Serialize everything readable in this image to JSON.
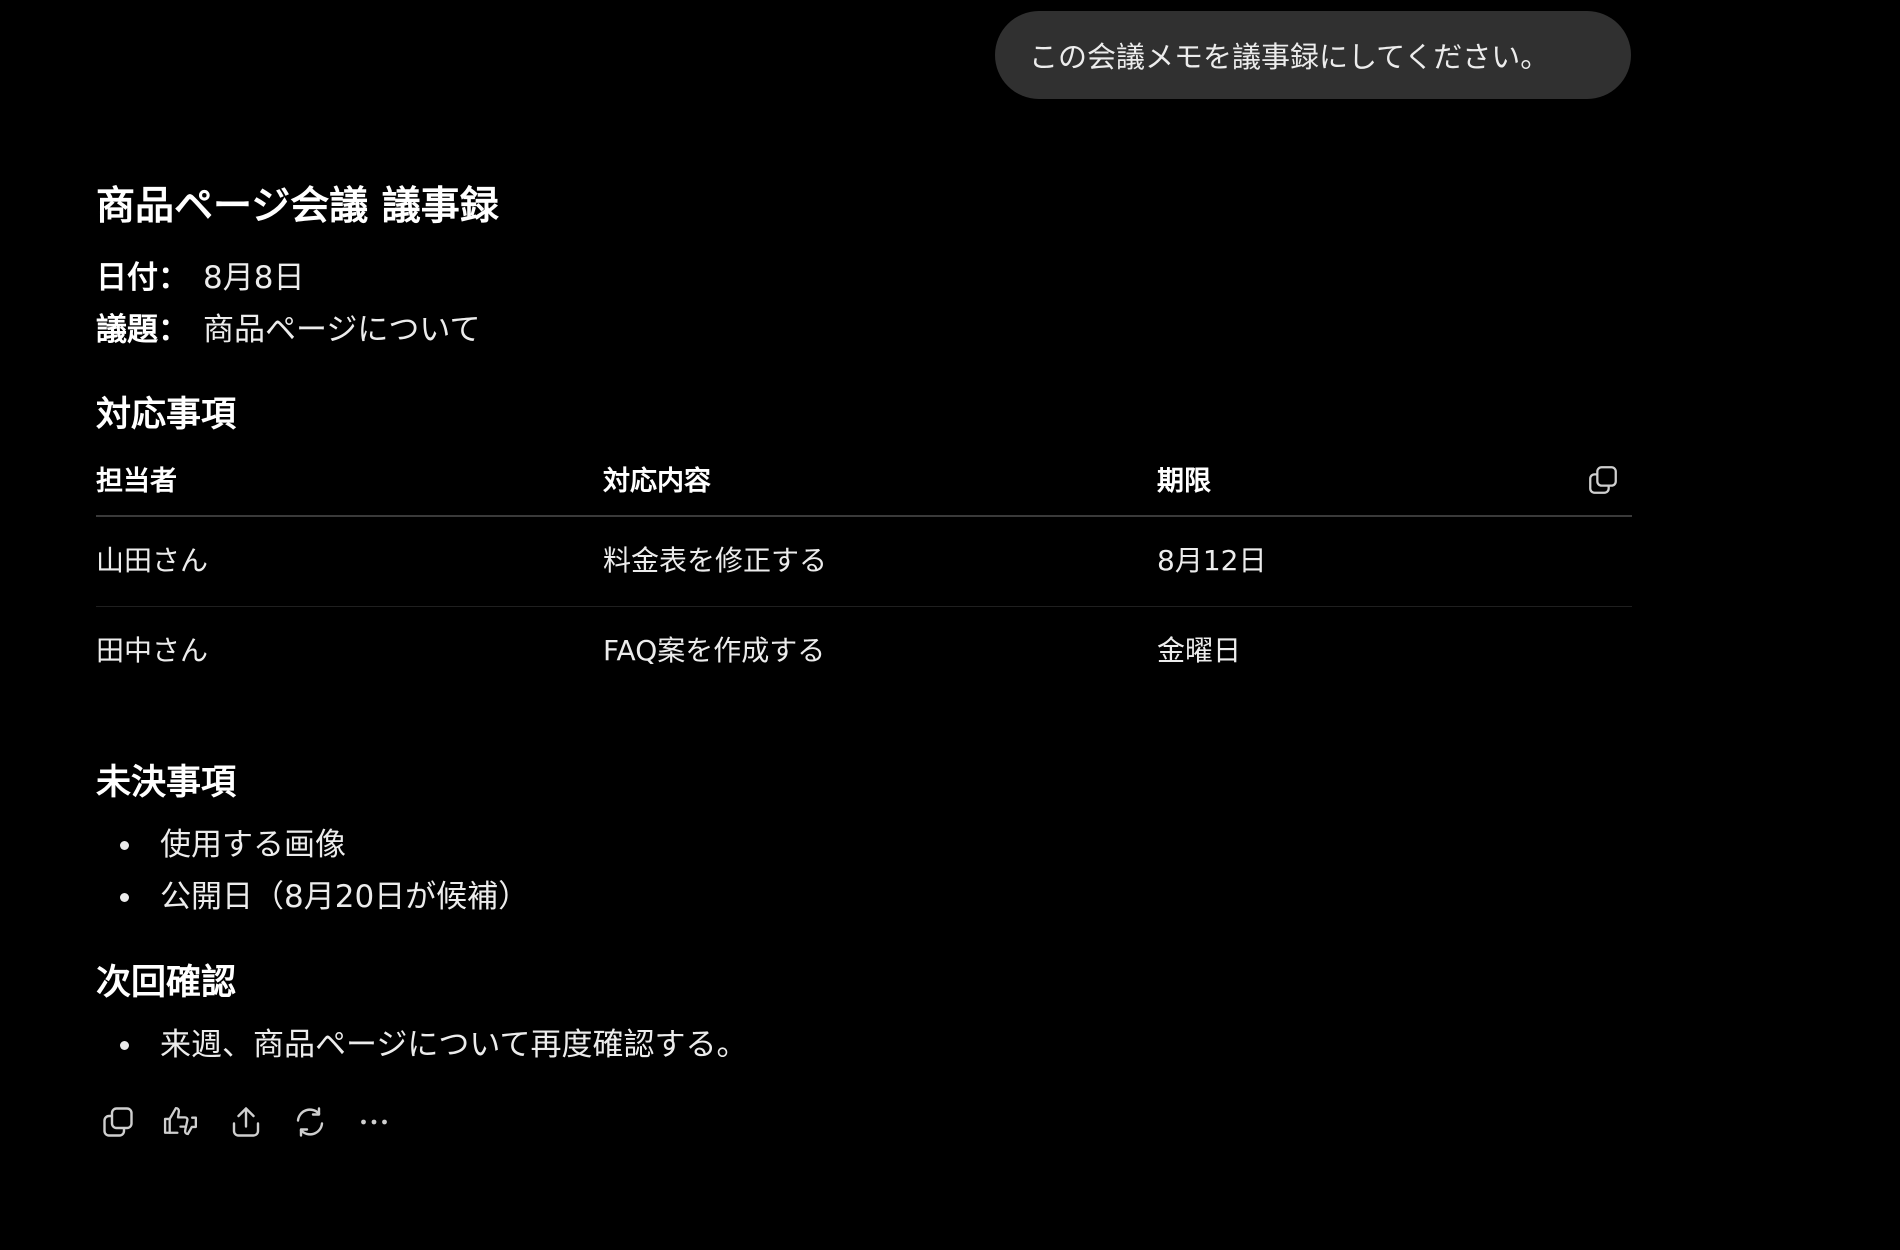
{
  "user_message": "この会議メモを議事録にしてください。",
  "document": {
    "title": "商品ページ会議 議事録",
    "date_label": "日付",
    "date_value": "8月8日",
    "topic_label": "議題",
    "topic_value": "商品ページについて",
    "separator": "："
  },
  "actions_section": {
    "heading": "対応事項",
    "columns": [
      "担当者",
      "対応内容",
      "期限"
    ],
    "rows": [
      [
        "山田さん",
        "料金表を修正する",
        "8月12日"
      ],
      [
        "田中さん",
        "FAQ案を作成する",
        "金曜日"
      ]
    ],
    "copy_icon": "copy-icon"
  },
  "pending_section": {
    "heading": "未決事項",
    "items": [
      "使用する画像",
      "公開日（8月20日が候補）"
    ]
  },
  "next_section": {
    "heading": "次回確認",
    "items": [
      "来週、商品ページについて再度確認する。"
    ]
  },
  "action_bar": {
    "icons": [
      "copy-icon",
      "thumbs-up-down-icon",
      "share-icon",
      "regenerate-icon",
      "more-icon"
    ]
  },
  "colors": {
    "background": "#000000",
    "text": "#ececec",
    "bubble": "#303030",
    "divider": "#3a3a3a"
  }
}
